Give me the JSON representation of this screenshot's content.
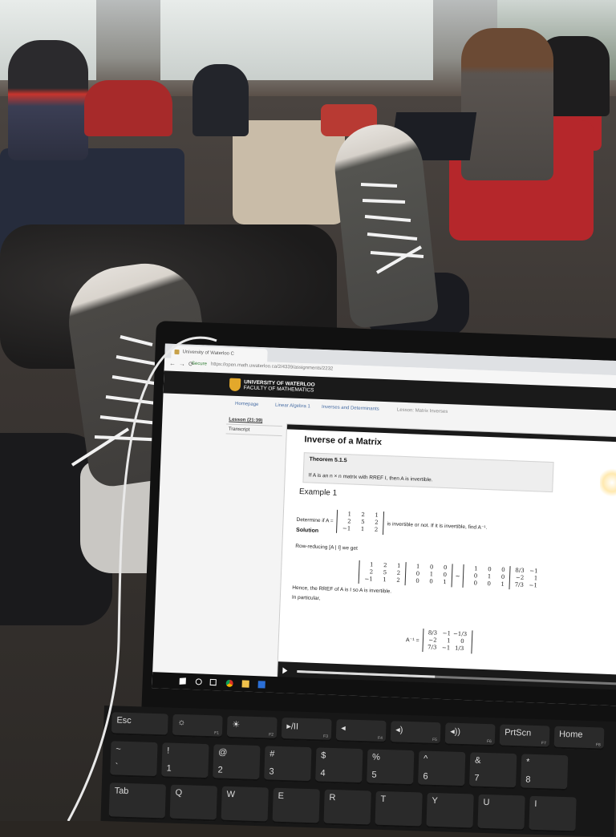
{
  "browser": {
    "tab_title": "University of Waterloo C",
    "address": "https://open.math.uwaterloo.ca/2/4339/assignments/2232",
    "secure_label": "Secure"
  },
  "site": {
    "header_line1": "UNIVERSITY OF WATERLOO",
    "header_line2": "FACULTY OF MATHEMATICS"
  },
  "breadcrumbs": [
    "Homepage",
    "Linear Algebra 1",
    "Inverses and Determinants",
    "Lesson: Matrix Inverses"
  ],
  "sidebar": {
    "items": [
      {
        "label": "Lesson (21:39)"
      },
      {
        "label": "Transcript"
      }
    ]
  },
  "lesson": {
    "title": "Inverse of a Matrix",
    "theorem_label": "Theorem 5.1.5",
    "theorem_text": "If A is an n × n matrix with RREF I, then A is invertible.",
    "example_label": "Example 1",
    "question_prefix": "Determine if A =",
    "question_suffix": "is invertible or not. If it is invertible, find A⁻¹.",
    "solution_label": "Solution",
    "row_reducing": "Row-reducing [A | I] we get",
    "hence": "Hence, the RREF of A is I so A is invertible.",
    "in_particular": "In particular,",
    "inverse_label": "A⁻¹ ="
  },
  "matrices": {
    "A": [
      [
        "1",
        "2",
        "1"
      ],
      [
        "2",
        "5",
        "2"
      ],
      [
        "−1",
        "1",
        "2"
      ]
    ],
    "augmented_left": [
      [
        "1",
        "2",
        "1"
      ],
      [
        "2",
        "5",
        "2"
      ],
      [
        "−1",
        "1",
        "2"
      ]
    ],
    "augmented_right": [
      [
        "1",
        "0",
        "0"
      ],
      [
        "0",
        "1",
        "0"
      ],
      [
        "0",
        "0",
        "1"
      ]
    ],
    "reduced_left": [
      [
        "1",
        "0",
        "0"
      ],
      [
        "0",
        "1",
        "0"
      ],
      [
        "0",
        "0",
        "1"
      ]
    ],
    "reduced_right": [
      [
        "8/3",
        "−1",
        ""
      ],
      [
        "−2",
        "1",
        ""
      ],
      [
        "7/3",
        "−1",
        ""
      ]
    ],
    "inverse": [
      [
        "8/3",
        "−1",
        "−1/3"
      ],
      [
        "−2",
        "1",
        "0"
      ],
      [
        "7/3",
        "−1",
        "1/3"
      ]
    ]
  },
  "video": {
    "progress_fraction": 0.43
  },
  "keyboard": {
    "row1": [
      {
        "label": "Esc",
        "sub": ""
      },
      {
        "label": "☼",
        "sub": "F1"
      },
      {
        "label": "☀",
        "sub": "F2"
      },
      {
        "label": "▸/II",
        "sub": "F3"
      },
      {
        "label": "◂",
        "sub": "F4"
      },
      {
        "label": "◂)",
        "sub": "F5"
      },
      {
        "label": "◂))",
        "sub": "F6"
      },
      {
        "label": "PrtScn",
        "sub": "F7"
      },
      {
        "label": "Home",
        "sub": "F8"
      }
    ],
    "row2": [
      {
        "label": "~",
        "sub": "`"
      },
      {
        "label": "!",
        "sub": "1"
      },
      {
        "label": "@",
        "sub": "2"
      },
      {
        "label": "#",
        "sub": "3"
      },
      {
        "label": "$",
        "sub": "4"
      },
      {
        "label": "%",
        "sub": "5"
      },
      {
        "label": "^",
        "sub": "6"
      },
      {
        "label": "&",
        "sub": "7"
      },
      {
        "label": "*",
        "sub": "8"
      }
    ],
    "row3": [
      {
        "label": "Tab",
        "sub": ""
      },
      {
        "label": "Q",
        "sub": ""
      },
      {
        "label": "W",
        "sub": ""
      },
      {
        "label": "E",
        "sub": ""
      },
      {
        "label": "R",
        "sub": ""
      },
      {
        "label": "T",
        "sub": ""
      },
      {
        "label": "Y",
        "sub": ""
      },
      {
        "label": "U",
        "sub": ""
      },
      {
        "label": "I",
        "sub": ""
      }
    ]
  },
  "colors": {
    "uw_gold": "#e3a82b",
    "chair_red": "#b5272b",
    "link_blue": "#4a6fa5"
  }
}
